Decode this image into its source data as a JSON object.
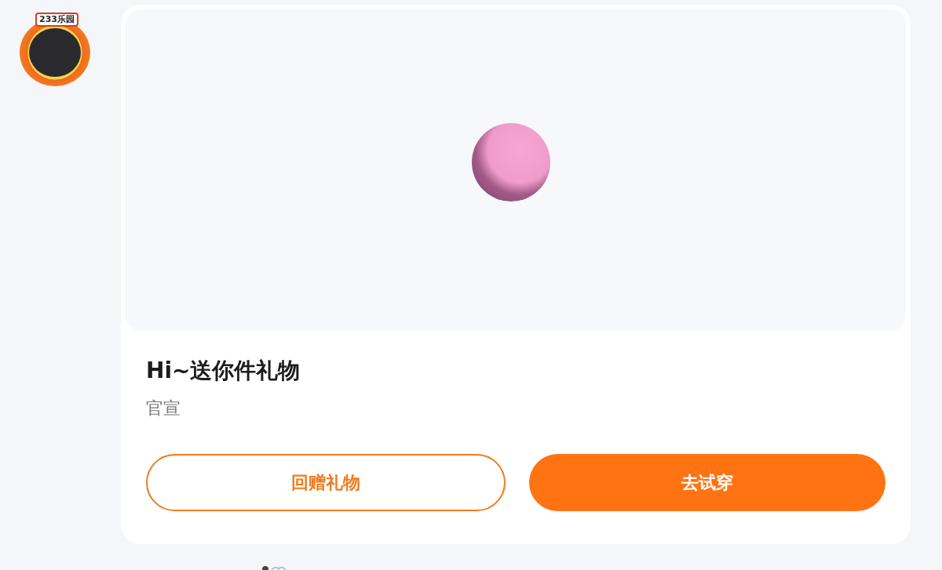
{
  "sender": {
    "frame_badge": "233乐园"
  },
  "gift": {
    "title": "Hi~送你件礼物",
    "subtitle": "官宣",
    "buttons": [
      {
        "label": "回赠礼物",
        "kind": "outline"
      },
      {
        "label": "去试穿",
        "kind": "filled"
      }
    ]
  }
}
